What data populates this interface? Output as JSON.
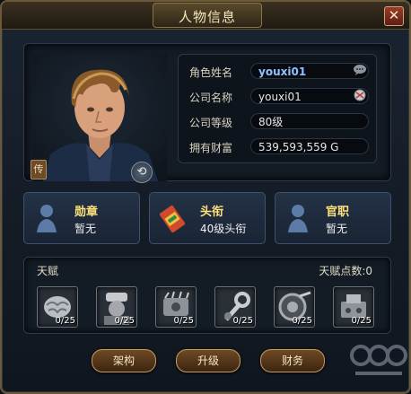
{
  "window": {
    "title": "人物信息",
    "close_glyph": "✕"
  },
  "portrait": {
    "tab_label": "传",
    "swap_glyph": "⟲"
  },
  "info": {
    "rows": [
      {
        "label": "角色姓名",
        "value": "youxi01",
        "icon": "chat-bubble-icon"
      },
      {
        "label": "公司名称",
        "value": "youxi01",
        "icon": "company-emblem-icon"
      },
      {
        "label": "公司等级",
        "value": "80级"
      },
      {
        "label": "拥有财富",
        "value": "539,593,559 G"
      }
    ]
  },
  "cards": [
    {
      "title": "勋章",
      "value": "暂无",
      "icon": "medal-silhouette-icon"
    },
    {
      "title": "头衔",
      "value": "40级头衔",
      "icon": "title-scroll-icon"
    },
    {
      "title": "官职",
      "value": "暂无",
      "icon": "official-silhouette-icon"
    }
  ],
  "talent": {
    "label": "天赋",
    "points_label": "天赋点数:0",
    "skills": [
      {
        "count": "0/25",
        "icon": "brain-icon"
      },
      {
        "count": "0/25",
        "icon": "engineer-icon"
      },
      {
        "count": "0/25",
        "icon": "engine-icon"
      },
      {
        "count": "0/25",
        "icon": "wrench-icon"
      },
      {
        "count": "0/25",
        "icon": "tire-icon"
      },
      {
        "count": "0/25",
        "icon": "machine-icon"
      }
    ]
  },
  "buttons": {
    "structure": "架构",
    "upgrade": "升级",
    "finance": "财务"
  },
  "colors": {
    "accent_gold": "#c79d5d",
    "name_blue": "#8fc3ff",
    "card_title": "#ffe27a"
  }
}
